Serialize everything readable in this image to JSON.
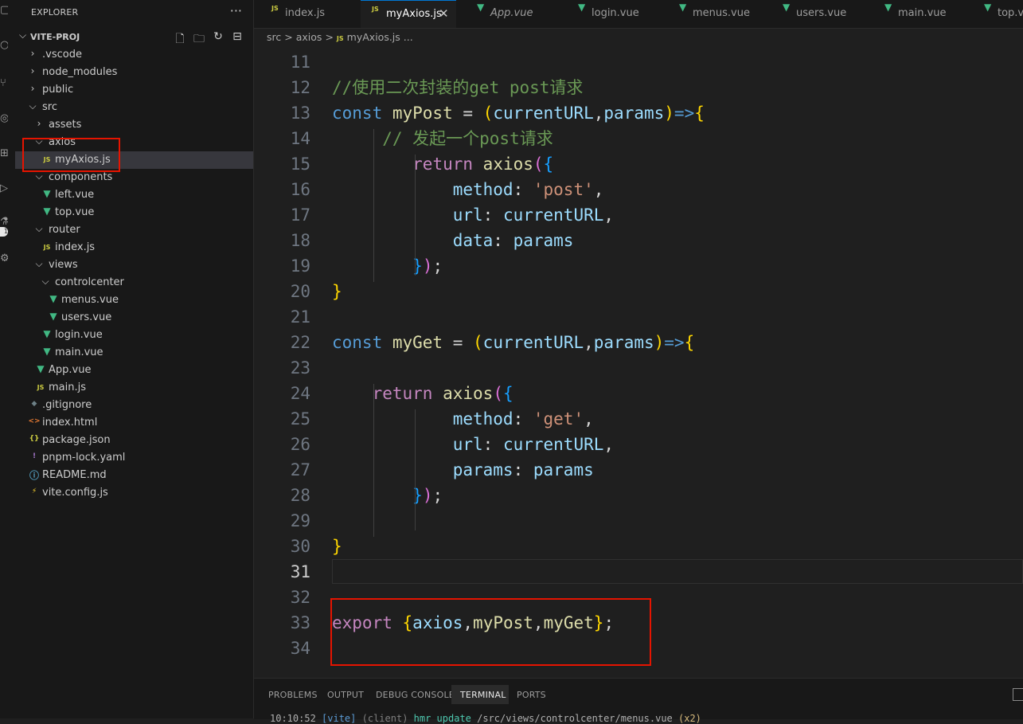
{
  "activity_bar": {
    "icons": [
      "files-icon",
      "search-icon",
      "source-control-icon",
      "run-debug-icon",
      "extensions-icon",
      "remote-icon",
      "testing-icon",
      "settings-icon"
    ],
    "badge": "1"
  },
  "explorer": {
    "title": "EXPLORER",
    "more": "···",
    "root": "VITE-PROJ",
    "actions": [
      "new-file-icon",
      "new-folder-icon",
      "refresh-icon",
      "collapse-icon"
    ],
    "tree": [
      {
        "label": ".vscode",
        "type": "folder",
        "expanded": false,
        "depth": 0
      },
      {
        "label": "node_modules",
        "type": "folder",
        "expanded": false,
        "depth": 0
      },
      {
        "label": "public",
        "type": "folder",
        "expanded": false,
        "depth": 0
      },
      {
        "label": "src",
        "type": "folder",
        "expanded": true,
        "depth": 0
      },
      {
        "label": "assets",
        "type": "folder",
        "expanded": false,
        "depth": 1
      },
      {
        "label": "axios",
        "type": "folder",
        "expanded": true,
        "depth": 1
      },
      {
        "label": "myAxios.js",
        "type": "js",
        "depth": 2,
        "selected": true
      },
      {
        "label": "components",
        "type": "folder",
        "expanded": true,
        "depth": 1
      },
      {
        "label": "left.vue",
        "type": "vue",
        "depth": 2
      },
      {
        "label": "top.vue",
        "type": "vue",
        "depth": 2
      },
      {
        "label": "router",
        "type": "folder",
        "expanded": true,
        "depth": 1
      },
      {
        "label": "index.js",
        "type": "js",
        "depth": 2
      },
      {
        "label": "views",
        "type": "folder",
        "expanded": true,
        "depth": 1
      },
      {
        "label": "controlcenter",
        "type": "folder",
        "expanded": true,
        "depth": 2
      },
      {
        "label": "menus.vue",
        "type": "vue",
        "depth": 3
      },
      {
        "label": "users.vue",
        "type": "vue",
        "depth": 3
      },
      {
        "label": "login.vue",
        "type": "vue",
        "depth": 2
      },
      {
        "label": "main.vue",
        "type": "vue",
        "depth": 2
      },
      {
        "label": "App.vue",
        "type": "vue",
        "depth": 1
      },
      {
        "label": "main.js",
        "type": "js",
        "depth": 1
      },
      {
        "label": ".gitignore",
        "type": "git",
        "depth": 0
      },
      {
        "label": "index.html",
        "type": "html",
        "depth": 0
      },
      {
        "label": "package.json",
        "type": "json",
        "depth": 0
      },
      {
        "label": "pnpm-lock.yaml",
        "type": "yaml",
        "depth": 0
      },
      {
        "label": "README.md",
        "type": "info",
        "depth": 0
      },
      {
        "label": "vite.config.js",
        "type": "vite",
        "depth": 0
      }
    ]
  },
  "tabs": [
    {
      "label": "index.js",
      "type": "js"
    },
    {
      "label": "myAxios.js",
      "type": "js",
      "active": true,
      "close": "✕"
    },
    {
      "label": "App.vue",
      "type": "vue",
      "italic": true
    },
    {
      "label": "login.vue",
      "type": "vue"
    },
    {
      "label": "menus.vue",
      "type": "vue"
    },
    {
      "label": "users.vue",
      "type": "vue"
    },
    {
      "label": "main.vue",
      "type": "vue"
    },
    {
      "label": "top.vue",
      "type": "vue"
    }
  ],
  "file_icons": {
    "js": "JS",
    "vue": "▼",
    "git": "◆",
    "html": "<>",
    "json": "{}",
    "yaml": "!",
    "info": "ⓘ",
    "vite": "⚡"
  },
  "breadcrumb": [
    "src",
    "axios",
    "myAxios.js",
    "..."
  ],
  "breadcrumb_sep": ">",
  "editor": {
    "current_line": 31,
    "lines": [
      {
        "n": 11,
        "tokens": []
      },
      {
        "n": 12,
        "tokens": [
          [
            "//使用二次封装的get post请求",
            "cm"
          ]
        ]
      },
      {
        "n": 13,
        "tokens": [
          [
            "const ",
            "kw"
          ],
          [
            "myPost",
            "fn"
          ],
          [
            " = ",
            "op"
          ],
          [
            "(",
            "b1"
          ],
          [
            "currentURL",
            "var"
          ],
          [
            ",",
            "op"
          ],
          [
            "params",
            "var"
          ],
          [
            ")",
            "b1"
          ],
          [
            "=>",
            "kw"
          ],
          [
            "{",
            "b1"
          ]
        ]
      },
      {
        "n": 14,
        "tokens": [
          [
            "     ",
            ""
          ],
          [
            "// 发起一个post请求",
            "cm"
          ]
        ]
      },
      {
        "n": 15,
        "tokens": [
          [
            "        ",
            ""
          ],
          [
            "return ",
            "ctl"
          ],
          [
            "axios",
            "fn"
          ],
          [
            "(",
            "b2"
          ],
          [
            "{",
            "b3"
          ]
        ]
      },
      {
        "n": 16,
        "tokens": [
          [
            "            ",
            ""
          ],
          [
            "method",
            "var"
          ],
          [
            ": ",
            "op"
          ],
          [
            "'post'",
            "str"
          ],
          [
            ",",
            "op"
          ]
        ]
      },
      {
        "n": 17,
        "tokens": [
          [
            "            ",
            ""
          ],
          [
            "url",
            "var"
          ],
          [
            ": ",
            "op"
          ],
          [
            "currentURL",
            "var"
          ],
          [
            ",",
            "op"
          ]
        ]
      },
      {
        "n": 18,
        "tokens": [
          [
            "            ",
            ""
          ],
          [
            "data",
            "var"
          ],
          [
            ": ",
            "op"
          ],
          [
            "params",
            "var"
          ]
        ]
      },
      {
        "n": 19,
        "tokens": [
          [
            "        ",
            ""
          ],
          [
            "}",
            "b3"
          ],
          [
            ")",
            "b2"
          ],
          [
            ";",
            "op"
          ]
        ]
      },
      {
        "n": 20,
        "tokens": [
          [
            "}",
            "b1"
          ]
        ]
      },
      {
        "n": 21,
        "tokens": []
      },
      {
        "n": 22,
        "tokens": [
          [
            "const ",
            "kw"
          ],
          [
            "myGet",
            "fn"
          ],
          [
            " = ",
            "op"
          ],
          [
            "(",
            "b1"
          ],
          [
            "currentURL",
            "var"
          ],
          [
            ",",
            "op"
          ],
          [
            "params",
            "var"
          ],
          [
            ")",
            "b1"
          ],
          [
            "=>",
            "kw"
          ],
          [
            "{",
            "b1"
          ]
        ]
      },
      {
        "n": 23,
        "tokens": []
      },
      {
        "n": 24,
        "tokens": [
          [
            "    ",
            ""
          ],
          [
            "return ",
            "ctl"
          ],
          [
            "axios",
            "fn"
          ],
          [
            "(",
            "b2"
          ],
          [
            "{",
            "b3"
          ]
        ]
      },
      {
        "n": 25,
        "tokens": [
          [
            "            ",
            ""
          ],
          [
            "method",
            "var"
          ],
          [
            ": ",
            "op"
          ],
          [
            "'get'",
            "str"
          ],
          [
            ",",
            "op"
          ]
        ]
      },
      {
        "n": 26,
        "tokens": [
          [
            "            ",
            ""
          ],
          [
            "url",
            "var"
          ],
          [
            ": ",
            "op"
          ],
          [
            "currentURL",
            "var"
          ],
          [
            ",",
            "op"
          ]
        ]
      },
      {
        "n": 27,
        "tokens": [
          [
            "            ",
            ""
          ],
          [
            "params",
            "var"
          ],
          [
            ": ",
            "op"
          ],
          [
            "params",
            "var"
          ]
        ]
      },
      {
        "n": 28,
        "tokens": [
          [
            "        ",
            ""
          ],
          [
            "}",
            "b3"
          ],
          [
            ")",
            "b2"
          ],
          [
            ";",
            "op"
          ]
        ]
      },
      {
        "n": 29,
        "tokens": []
      },
      {
        "n": 30,
        "tokens": [
          [
            "}",
            "b1"
          ]
        ]
      },
      {
        "n": 31,
        "tokens": []
      },
      {
        "n": 32,
        "tokens": []
      },
      {
        "n": 33,
        "tokens": [
          [
            "export ",
            "ctl"
          ],
          [
            "{",
            "b1"
          ],
          [
            "axios",
            "var"
          ],
          [
            ",",
            "op"
          ],
          [
            "myPost",
            "fn"
          ],
          [
            ",",
            "op"
          ],
          [
            "myGet",
            "fn"
          ],
          [
            "}",
            "b1"
          ],
          [
            ";",
            "op"
          ]
        ]
      },
      {
        "n": 34,
        "tokens": []
      }
    ]
  },
  "panel": {
    "tabs": [
      "PROBLEMS",
      "OUTPUT",
      "DEBUG CONSOLE",
      "TERMINAL",
      "PORTS"
    ],
    "active": "TERMINAL",
    "terminal_line": [
      [
        "10:10:52 ",
        "t4"
      ],
      [
        "[vite]",
        "t1"
      ],
      [
        " (client) ",
        "t2"
      ],
      [
        "hmr update ",
        "t3"
      ],
      [
        "/src/views/controlcenter/menus.vue ",
        "t4"
      ],
      [
        "(x2)",
        "t5"
      ]
    ]
  }
}
